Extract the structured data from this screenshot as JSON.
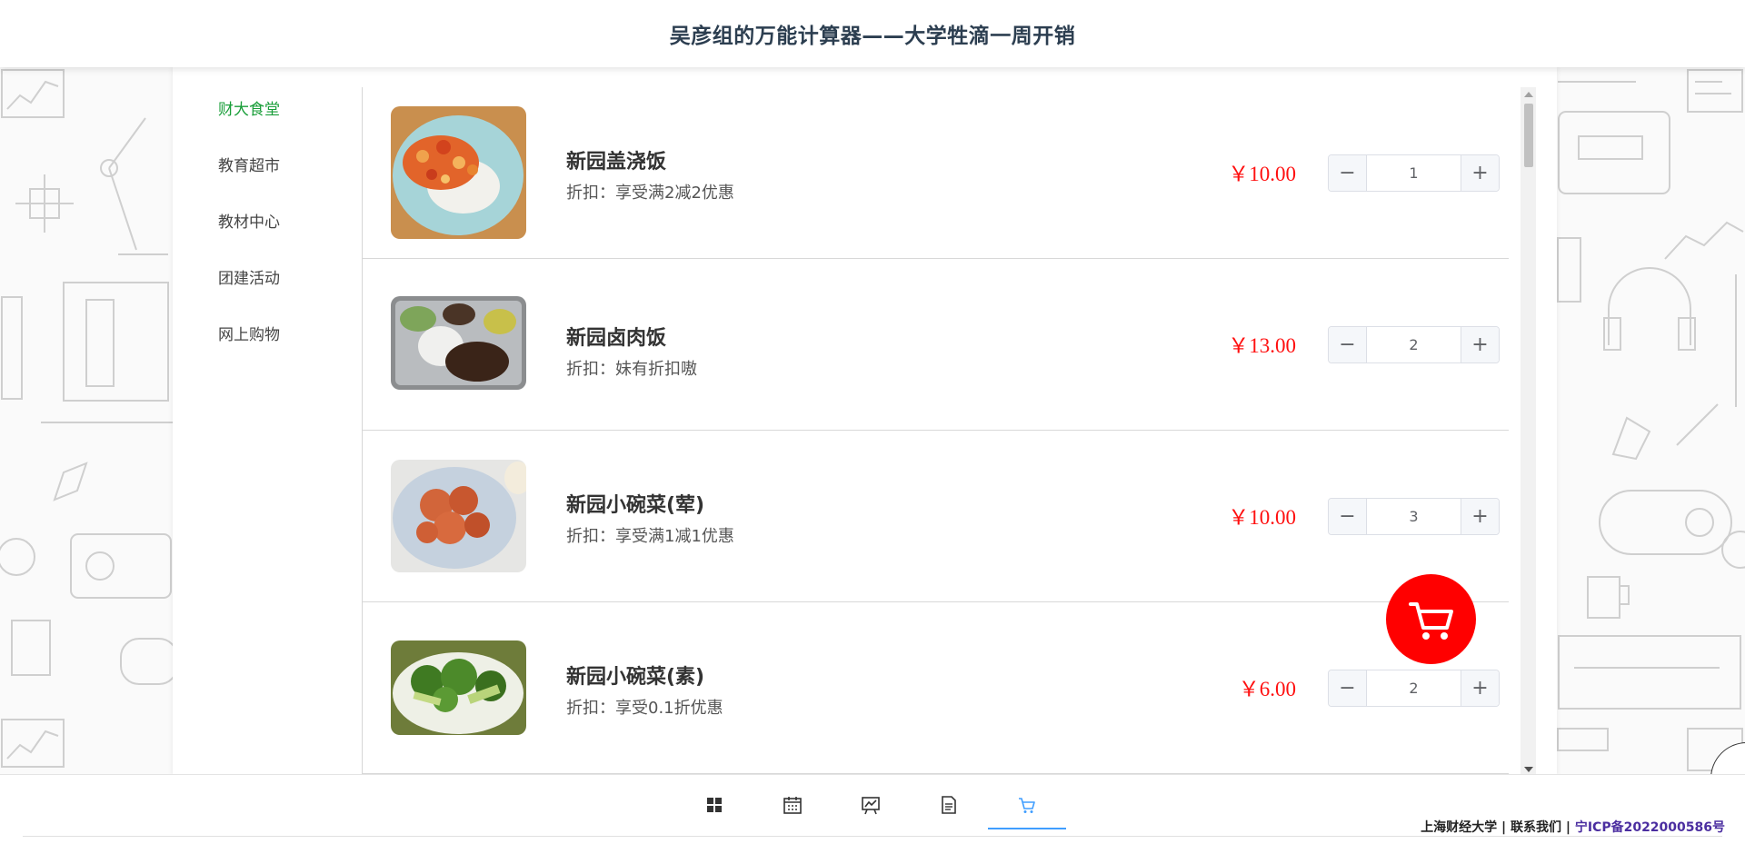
{
  "header": {
    "title": "吴彦组的万能计算器——大学牲滴一周开销"
  },
  "menu": {
    "items": [
      {
        "label": "财大食堂"
      },
      {
        "label": "教育超市"
      },
      {
        "label": "教材中心"
      },
      {
        "label": "团建活动"
      },
      {
        "label": "网上购物"
      }
    ],
    "active_color": "#1a9e3a"
  },
  "products": [
    {
      "name": "新园盖浇饭",
      "discount": "折扣：享受满2减2优惠",
      "price": "￥10.00",
      "qty": "1",
      "icon": "rice-with-topping-photo"
    },
    {
      "name": "新园卤肉饭",
      "discount": "折扣：妹有折扣嗷",
      "price": "￥13.00",
      "qty": "2",
      "icon": "braised-pork-rice-photo"
    },
    {
      "name": "新园小碗菜(荤)",
      "discount": "折扣：享受满1减1优惠",
      "price": "￥10.00",
      "qty": "3",
      "icon": "meat-dish-photo"
    },
    {
      "name": "新园小碗菜(素)",
      "discount": "折扣：享受0.1折优惠",
      "price": "￥6.00",
      "qty": "2",
      "icon": "broccoli-dish-photo"
    }
  ],
  "stepper": {
    "minus": "−",
    "plus": "+"
  },
  "colors": {
    "price": "#ff1010",
    "cart_fab": "#ff0000",
    "active_tab": "#409eff"
  },
  "tabs": [
    {
      "icon": "grid-icon"
    },
    {
      "icon": "calendar-icon"
    },
    {
      "icon": "presentation-chart-icon"
    },
    {
      "icon": "document-icon"
    },
    {
      "icon": "cart-icon",
      "active": true
    }
  ],
  "footer": {
    "school": "上海财经大学",
    "sep1": " | ",
    "contact": "联系我们",
    "sep2": " | ",
    "icp": "宁ICP备2022000586号"
  }
}
